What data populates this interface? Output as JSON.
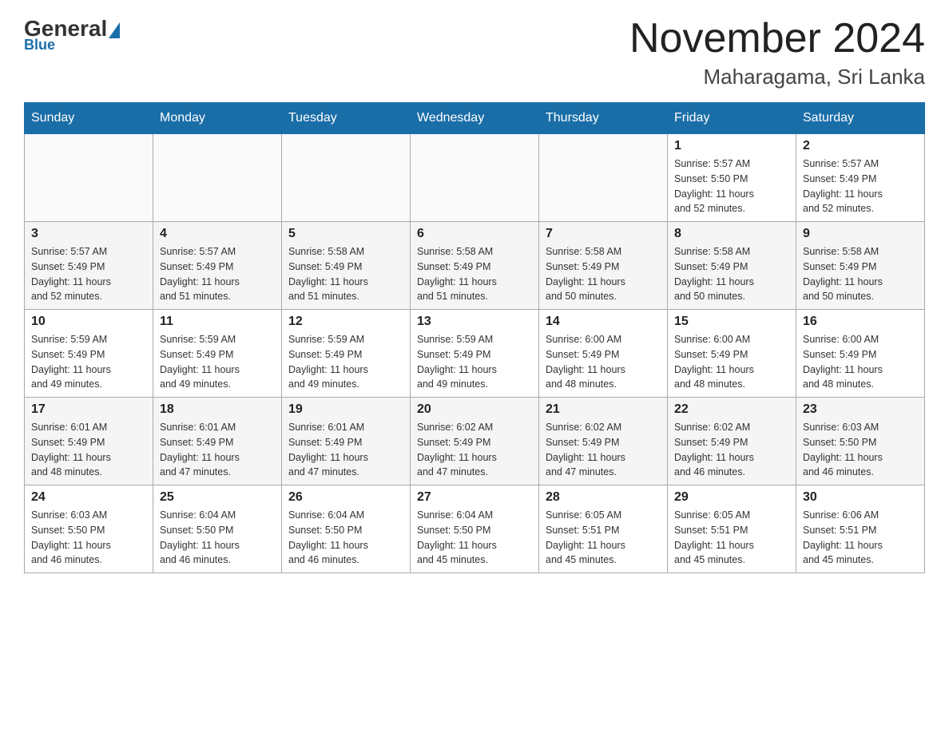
{
  "header": {
    "title": "November 2024",
    "subtitle": "Maharagama, Sri Lanka",
    "logo_general": "General",
    "logo_blue": "Blue"
  },
  "days_of_week": [
    "Sunday",
    "Monday",
    "Tuesday",
    "Wednesday",
    "Thursday",
    "Friday",
    "Saturday"
  ],
  "weeks": [
    [
      {
        "day": "",
        "info": ""
      },
      {
        "day": "",
        "info": ""
      },
      {
        "day": "",
        "info": ""
      },
      {
        "day": "",
        "info": ""
      },
      {
        "day": "",
        "info": ""
      },
      {
        "day": "1",
        "info": "Sunrise: 5:57 AM\nSunset: 5:50 PM\nDaylight: 11 hours\nand 52 minutes."
      },
      {
        "day": "2",
        "info": "Sunrise: 5:57 AM\nSunset: 5:49 PM\nDaylight: 11 hours\nand 52 minutes."
      }
    ],
    [
      {
        "day": "3",
        "info": "Sunrise: 5:57 AM\nSunset: 5:49 PM\nDaylight: 11 hours\nand 52 minutes."
      },
      {
        "day": "4",
        "info": "Sunrise: 5:57 AM\nSunset: 5:49 PM\nDaylight: 11 hours\nand 51 minutes."
      },
      {
        "day": "5",
        "info": "Sunrise: 5:58 AM\nSunset: 5:49 PM\nDaylight: 11 hours\nand 51 minutes."
      },
      {
        "day": "6",
        "info": "Sunrise: 5:58 AM\nSunset: 5:49 PM\nDaylight: 11 hours\nand 51 minutes."
      },
      {
        "day": "7",
        "info": "Sunrise: 5:58 AM\nSunset: 5:49 PM\nDaylight: 11 hours\nand 50 minutes."
      },
      {
        "day": "8",
        "info": "Sunrise: 5:58 AM\nSunset: 5:49 PM\nDaylight: 11 hours\nand 50 minutes."
      },
      {
        "day": "9",
        "info": "Sunrise: 5:58 AM\nSunset: 5:49 PM\nDaylight: 11 hours\nand 50 minutes."
      }
    ],
    [
      {
        "day": "10",
        "info": "Sunrise: 5:59 AM\nSunset: 5:49 PM\nDaylight: 11 hours\nand 49 minutes."
      },
      {
        "day": "11",
        "info": "Sunrise: 5:59 AM\nSunset: 5:49 PM\nDaylight: 11 hours\nand 49 minutes."
      },
      {
        "day": "12",
        "info": "Sunrise: 5:59 AM\nSunset: 5:49 PM\nDaylight: 11 hours\nand 49 minutes."
      },
      {
        "day": "13",
        "info": "Sunrise: 5:59 AM\nSunset: 5:49 PM\nDaylight: 11 hours\nand 49 minutes."
      },
      {
        "day": "14",
        "info": "Sunrise: 6:00 AM\nSunset: 5:49 PM\nDaylight: 11 hours\nand 48 minutes."
      },
      {
        "day": "15",
        "info": "Sunrise: 6:00 AM\nSunset: 5:49 PM\nDaylight: 11 hours\nand 48 minutes."
      },
      {
        "day": "16",
        "info": "Sunrise: 6:00 AM\nSunset: 5:49 PM\nDaylight: 11 hours\nand 48 minutes."
      }
    ],
    [
      {
        "day": "17",
        "info": "Sunrise: 6:01 AM\nSunset: 5:49 PM\nDaylight: 11 hours\nand 48 minutes."
      },
      {
        "day": "18",
        "info": "Sunrise: 6:01 AM\nSunset: 5:49 PM\nDaylight: 11 hours\nand 47 minutes."
      },
      {
        "day": "19",
        "info": "Sunrise: 6:01 AM\nSunset: 5:49 PM\nDaylight: 11 hours\nand 47 minutes."
      },
      {
        "day": "20",
        "info": "Sunrise: 6:02 AM\nSunset: 5:49 PM\nDaylight: 11 hours\nand 47 minutes."
      },
      {
        "day": "21",
        "info": "Sunrise: 6:02 AM\nSunset: 5:49 PM\nDaylight: 11 hours\nand 47 minutes."
      },
      {
        "day": "22",
        "info": "Sunrise: 6:02 AM\nSunset: 5:49 PM\nDaylight: 11 hours\nand 46 minutes."
      },
      {
        "day": "23",
        "info": "Sunrise: 6:03 AM\nSunset: 5:50 PM\nDaylight: 11 hours\nand 46 minutes."
      }
    ],
    [
      {
        "day": "24",
        "info": "Sunrise: 6:03 AM\nSunset: 5:50 PM\nDaylight: 11 hours\nand 46 minutes."
      },
      {
        "day": "25",
        "info": "Sunrise: 6:04 AM\nSunset: 5:50 PM\nDaylight: 11 hours\nand 46 minutes."
      },
      {
        "day": "26",
        "info": "Sunrise: 6:04 AM\nSunset: 5:50 PM\nDaylight: 11 hours\nand 46 minutes."
      },
      {
        "day": "27",
        "info": "Sunrise: 6:04 AM\nSunset: 5:50 PM\nDaylight: 11 hours\nand 45 minutes."
      },
      {
        "day": "28",
        "info": "Sunrise: 6:05 AM\nSunset: 5:51 PM\nDaylight: 11 hours\nand 45 minutes."
      },
      {
        "day": "29",
        "info": "Sunrise: 6:05 AM\nSunset: 5:51 PM\nDaylight: 11 hours\nand 45 minutes."
      },
      {
        "day": "30",
        "info": "Sunrise: 6:06 AM\nSunset: 5:51 PM\nDaylight: 11 hours\nand 45 minutes."
      }
    ]
  ]
}
